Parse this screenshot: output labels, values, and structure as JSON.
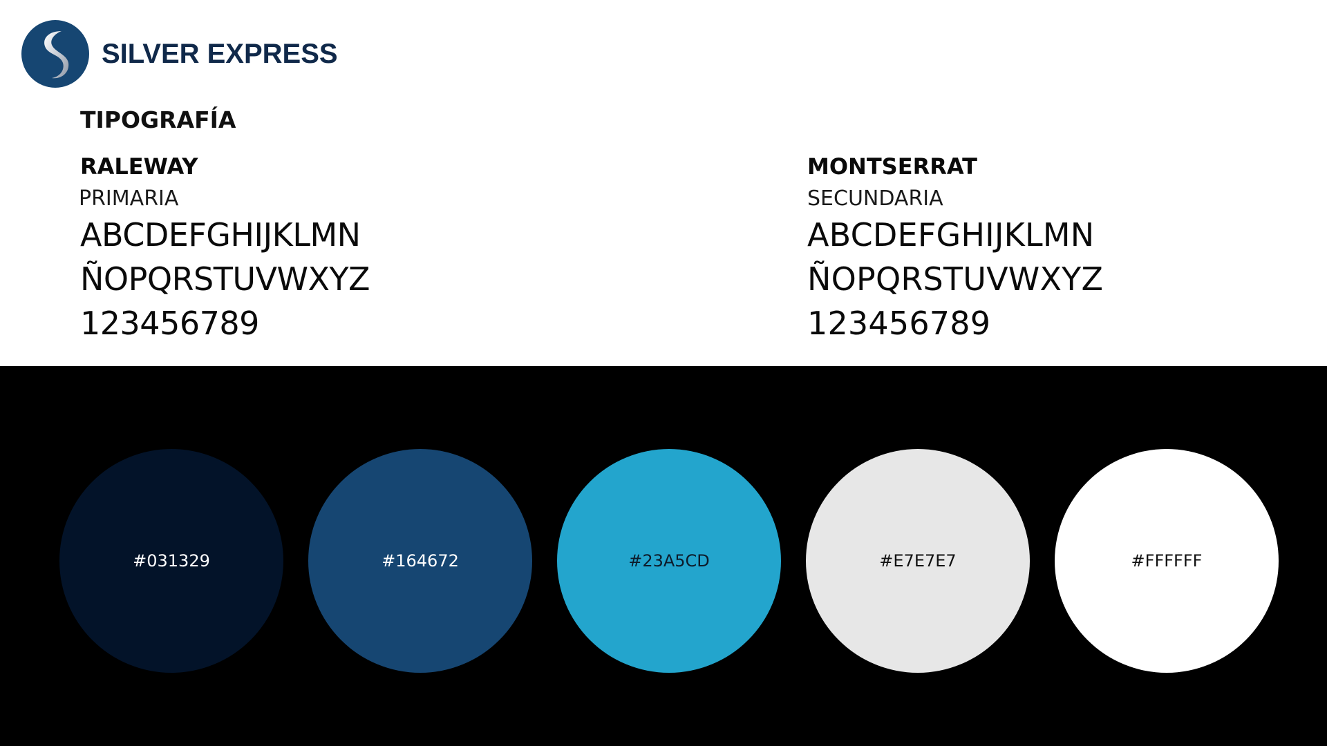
{
  "brand": {
    "name": "SILVER EXPRESS",
    "logo_icon": "s-swirl-logo-icon"
  },
  "typography": {
    "title": "TIPOGRAFÍA",
    "fonts": [
      {
        "name": "RALEWAY",
        "role": "PRIMARIA",
        "specimen": [
          "ABCDEFGHIJKLMN",
          "ÑOPQRSTUVWXYZ",
          "123456789"
        ]
      },
      {
        "name": "MONTSERRAT",
        "role": "SECUNDARIA",
        "specimen": [
          "ABCDEFGHIJKLMN",
          "ÑOPQRSTUVWXYZ",
          "123456789"
        ]
      }
    ]
  },
  "palette": [
    {
      "hex": "#031329",
      "label": "#031329",
      "text_color": "#ffffff"
    },
    {
      "hex": "#164672",
      "label": "#164672",
      "text_color": "#ffffff"
    },
    {
      "hex": "#23A5CD",
      "label": "#23A5CD",
      "text_color": "#0d1b2a"
    },
    {
      "hex": "#E7E7E7",
      "label": "#E7E7E7",
      "text_color": "#111111"
    },
    {
      "hex": "#FFFFFF",
      "label": "#FFFFFF",
      "text_color": "#111111"
    }
  ]
}
